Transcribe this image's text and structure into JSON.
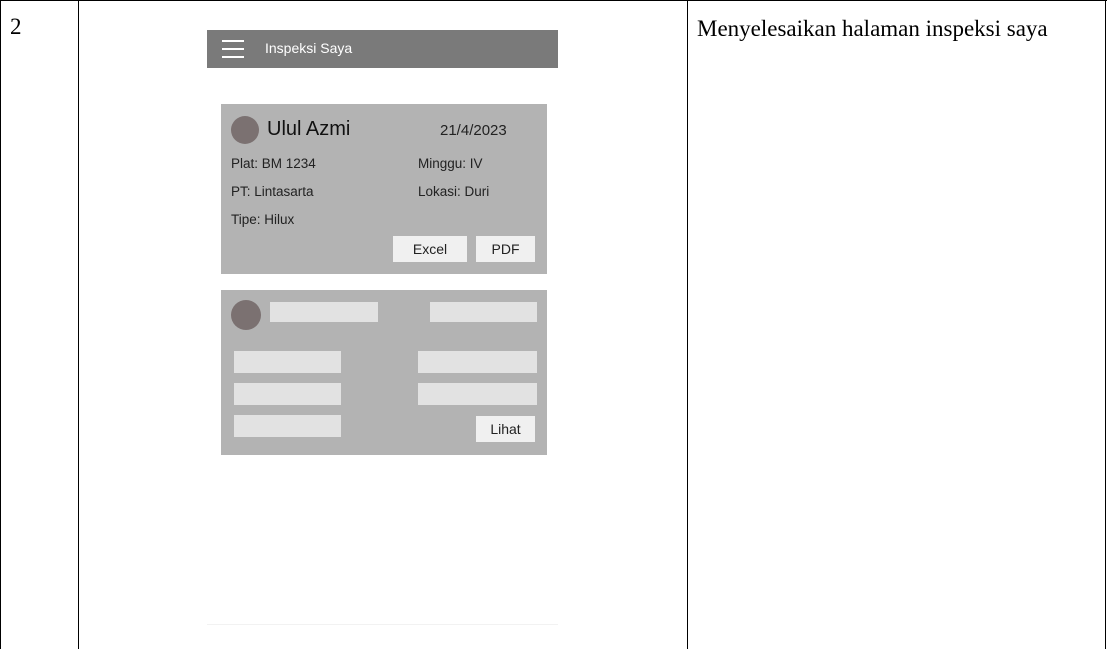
{
  "row": {
    "number": "2",
    "description": "Menyelesaikan halaman inspeksi saya"
  },
  "app": {
    "title": "Inspeksi Saya",
    "menu_icon": "hamburger-menu-icon"
  },
  "card1": {
    "name": "Ulul Azmi",
    "date": "21/4/2023",
    "plat": "Plat: BM 1234",
    "minggu": "Minggu: IV",
    "pt": "PT: Lintasarta",
    "lokasi": "Lokasi: Duri",
    "tipe": "Tipe: Hilux",
    "excel_label": "Excel",
    "pdf_label": "PDF"
  },
  "card2": {
    "view_label": "Lihat"
  },
  "colors": {
    "appbar": "#7a7a7a",
    "card": "#b3b3b3",
    "avatar": "#7b7171",
    "button": "#f0f0f0",
    "placeholder": "#e2e2e2"
  }
}
